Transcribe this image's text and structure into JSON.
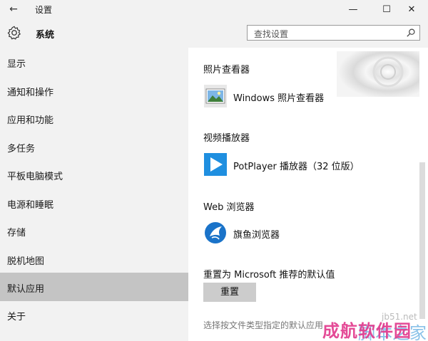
{
  "window": {
    "title": "设置",
    "back_glyph": "←",
    "minimize_glyph": "—",
    "maximize_glyph": "☐",
    "close_glyph": "✕"
  },
  "header": {
    "section_title": "系统",
    "search_placeholder": "查找设置"
  },
  "sidebar": {
    "items": [
      {
        "label": "显示"
      },
      {
        "label": "通知和操作"
      },
      {
        "label": "应用和功能"
      },
      {
        "label": "多任务"
      },
      {
        "label": "平板电脑模式"
      },
      {
        "label": "电源和睡眠"
      },
      {
        "label": "存储"
      },
      {
        "label": "脱机地图"
      },
      {
        "label": "默认应用",
        "active": true
      },
      {
        "label": "关于"
      }
    ]
  },
  "main": {
    "photo_viewer": {
      "heading": "照片查看器",
      "app_name": "Windows 照片查看器"
    },
    "video_player": {
      "heading": "视频播放器",
      "app_name": "PotPlayer 播放器（32 位版）"
    },
    "web_browser": {
      "heading": "Web 浏览器",
      "app_name": "旗鱼浏览器"
    },
    "reset": {
      "heading": "重置为 Microsoft 推荐的默认值",
      "button_label": "重置"
    },
    "bottom_link": "选择按文件类型指定的默认应用"
  },
  "watermark": {
    "site": "jb51.net",
    "text_cn": "成航软件园",
    "text_cn2": "脚本之家"
  },
  "colors": {
    "chrome_bg": "#f2f2f2",
    "active_item": "#c4c4c4",
    "button_bg": "#cccccc",
    "potplayer_blue": "#1f8fe0",
    "browser_blue": "#1a73c9"
  }
}
